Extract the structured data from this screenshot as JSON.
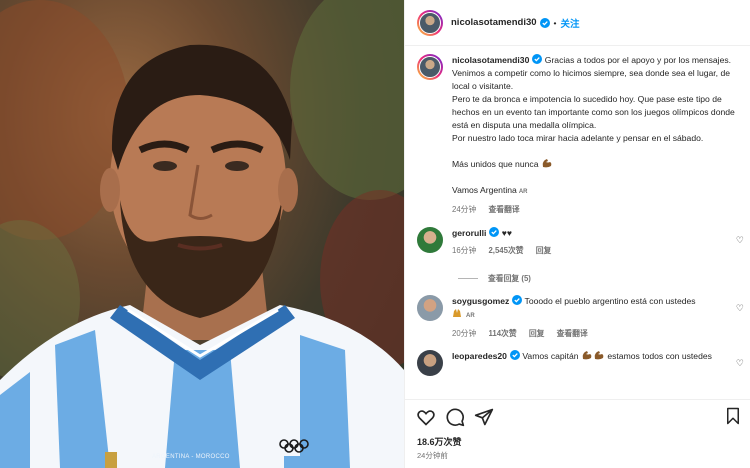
{
  "header": {
    "username": "nicolasotamendi30",
    "follow_label": "关注",
    "separator": "•"
  },
  "photo": {
    "jersey_caption": "ARGENTINA - MOROCCO"
  },
  "post": {
    "username": "nicolasotamendi30",
    "line1": "Gracias a todos por el apoyo y por los mensajes.",
    "line2": "Venimos a competir como lo hicimos siempre, sea donde sea el lugar, de local o visitante.",
    "line3": "Pero te da bronca e impotencia lo sucedido hoy. Que pase este tipo de hechos en un evento tan importante como son los juegos olímpicos donde está en disputa una medalla olímpica.",
    "line4": "Por nuestro lado toca mirar hacia adelante y pensar en el sábado.",
    "line5": "Más unidos que nunca",
    "line6": "Vamos Argentina",
    "flag": "AR",
    "time": "24分钟",
    "see_translation": "查看翻译"
  },
  "comments": [
    {
      "username": "gerorulli",
      "text": "♥♥",
      "time": "16分钟",
      "likes": "2,545次赞",
      "reply": "回复",
      "replies_label": "查看回复 (5)"
    },
    {
      "username": "soygusgomez",
      "text": "Tooodo el pueblo argentino está con ustedes",
      "flag": "AR",
      "time": "20分钟",
      "likes": "114次赞",
      "reply": "回复",
      "see_translation": "查看翻译"
    },
    {
      "username": "leoparedes20",
      "text": "Vamos capitán",
      "text2": "estamos todos con ustedes"
    }
  ],
  "footer": {
    "likes": "18.6万次赞",
    "time": "24分钟前"
  },
  "icons": [
    "heart-icon",
    "comment-icon",
    "share-icon",
    "bookmark-icon",
    "verified-icon",
    "like-heart-icon"
  ],
  "colors": {
    "accent": "#0095f6",
    "text": "#262626",
    "muted": "#737373",
    "jersey_blue": "#6cace4"
  }
}
